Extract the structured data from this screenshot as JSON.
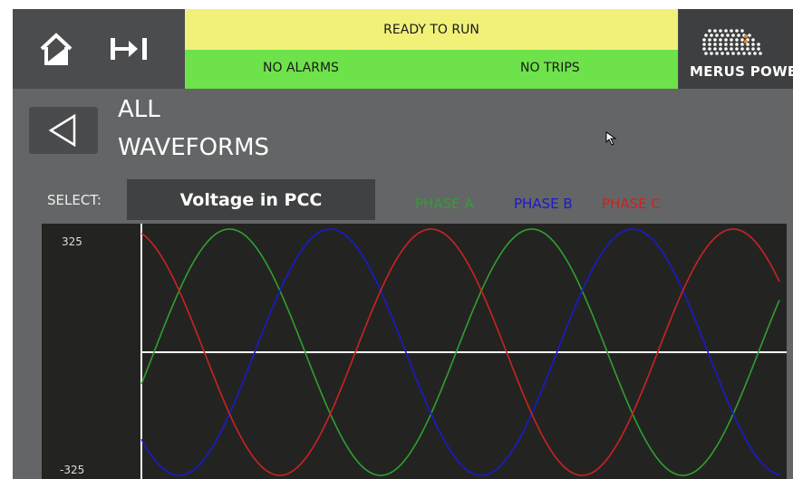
{
  "header": {
    "status_ready": "READY TO RUN",
    "alarms": "NO ALARMS",
    "trips": "NO TRIPS",
    "logo_text": "MERUS POWE"
  },
  "page": {
    "title_line1": "ALL",
    "title_line2": "WAVEFORMS"
  },
  "selector": {
    "label": "SELECT:",
    "value": "Voltage in PCC"
  },
  "legend": [
    {
      "label": "PHASE A",
      "color": "#2fa02f"
    },
    {
      "label": "PHASE B",
      "color": "#1a1acc"
    },
    {
      "label": "PHASE C",
      "color": "#cc2222"
    }
  ],
  "colors": {
    "ready_bg": "#f1f17a",
    "ok_bg": "#6ee24a",
    "chart_bg": "#232422"
  },
  "icons": [
    "home-icon",
    "step-forward-icon",
    "back-arrow-icon",
    "merus-logo-icon",
    "mouse-pointer-icon"
  ],
  "chart_data": {
    "type": "line",
    "y_ticks": [
      "325",
      "-325"
    ],
    "ylim": [
      -325,
      325
    ],
    "x_range_deg": [
      0,
      720
    ],
    "series": [
      {
        "name": "PHASE A",
        "color": "#2fa02f",
        "amplitude": 325,
        "phase_deg": 0,
        "x_deg": [
          0,
          30,
          60,
          90,
          120,
          150,
          180,
          210,
          240,
          270,
          300,
          330,
          360,
          390,
          420,
          450,
          480,
          510,
          540,
          570,
          600,
          630,
          660,
          690,
          720
        ],
        "values": [
          0,
          163,
          281,
          325,
          281,
          163,
          0,
          -163,
          -281,
          -325,
          -281,
          -163,
          0,
          163,
          281,
          325,
          281,
          163,
          0,
          -163,
          -281,
          -325,
          -281,
          -163,
          0
        ]
      },
      {
        "name": "PHASE B",
        "color": "#1a1acc",
        "amplitude": 325,
        "phase_deg": -120,
        "x_deg": [
          0,
          30,
          60,
          90,
          120,
          150,
          180,
          210,
          240,
          270,
          300,
          330,
          360,
          390,
          420,
          450,
          480,
          510,
          540,
          570,
          600,
          630,
          660,
          690,
          720
        ],
        "values": [
          -281,
          -325,
          -281,
          -163,
          0,
          163,
          281,
          325,
          281,
          163,
          0,
          -163,
          -281,
          -325,
          -281,
          -163,
          0,
          163,
          281,
          325,
          281,
          163,
          0,
          -163,
          -281
        ]
      },
      {
        "name": "PHASE C",
        "color": "#cc2222",
        "amplitude": 325,
        "phase_deg": 120,
        "x_deg": [
          0,
          30,
          60,
          90,
          120,
          150,
          180,
          210,
          240,
          270,
          300,
          330,
          360,
          390,
          420,
          450,
          480,
          510,
          540,
          570,
          600,
          630,
          660,
          690,
          720
        ],
        "values": [
          281,
          163,
          0,
          -163,
          -281,
          -325,
          -281,
          -163,
          0,
          163,
          281,
          325,
          281,
          163,
          0,
          -163,
          -281,
          -325,
          -281,
          -163,
          0,
          163,
          281,
          325,
          281
        ]
      }
    ]
  }
}
